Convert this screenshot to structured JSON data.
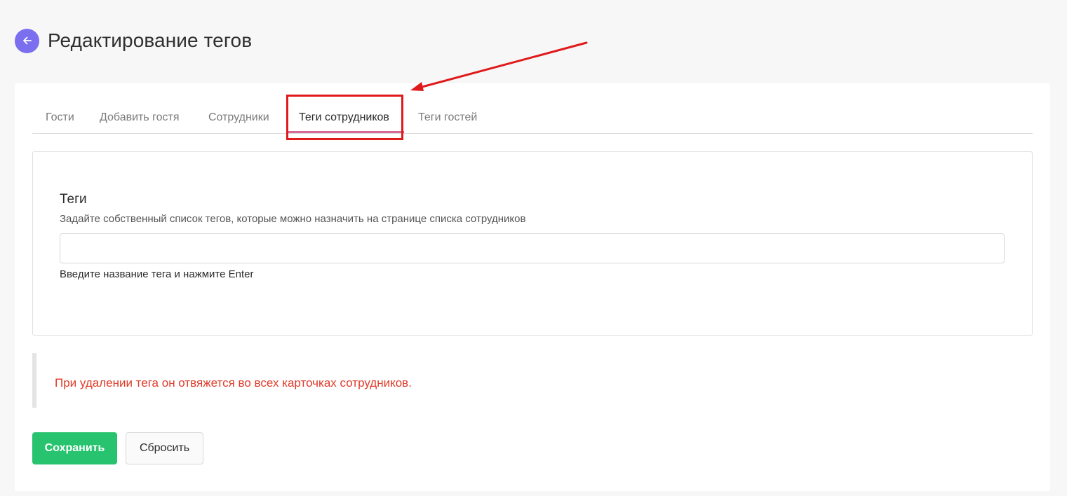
{
  "header": {
    "title": "Редактирование тегов",
    "back_icon": "arrow-left-icon"
  },
  "tabs": [
    {
      "label": "Гости",
      "active": false
    },
    {
      "label": "Добавить гостя",
      "active": false
    },
    {
      "label": "Сотрудники",
      "active": false
    },
    {
      "label": "Теги сотрудников",
      "active": true
    },
    {
      "label": "Теги гостей",
      "active": false
    }
  ],
  "form": {
    "title": "Теги",
    "description": "Задайте собственный список тегов, которые можно назначить на странице списка сотрудников",
    "input_value": "",
    "hint": "Введите название тега и нажмите Enter"
  },
  "warning": {
    "text": "При удалении тега он отвяжется во всех карточках сотрудников."
  },
  "actions": {
    "save_label": "Сохранить",
    "reset_label": "Сбросить"
  },
  "colors": {
    "accent": "#7b6ff0",
    "tab_underline": "#d86a9a",
    "save_button": "#27c36e",
    "warning_text": "#e03b2a",
    "annotation": "#e01a1a"
  }
}
